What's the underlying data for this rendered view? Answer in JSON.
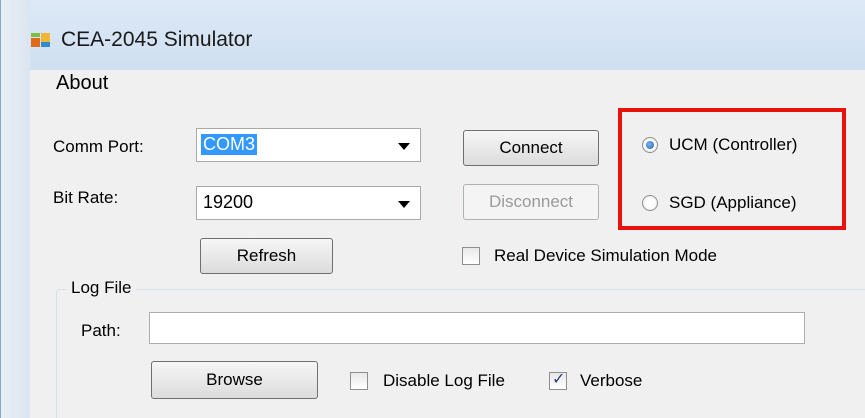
{
  "window": {
    "title": "CEA-2045 Simulator",
    "icon": "app-window-icon"
  },
  "menu": {
    "about": "About"
  },
  "connection": {
    "comm_port_label": "Comm Port:",
    "comm_port_value": "COM3",
    "bit_rate_label": "Bit Rate:",
    "bit_rate_value": "19200",
    "connect_label": "Connect",
    "disconnect_label": "Disconnect",
    "refresh_label": "Refresh",
    "real_device_label": "Real Device Simulation Mode",
    "real_device_checked": false
  },
  "mode": {
    "ucm_label": "UCM (Controller)",
    "sgd_label": "SGD (Appliance)",
    "selected": "UCM (Controller)",
    "highlight_color": "#e8120c"
  },
  "log_file": {
    "group_title": "Log File",
    "path_label": "Path:",
    "path_value": "",
    "browse_label": "Browse",
    "disable_label": "Disable Log File",
    "disable_checked": false,
    "verbose_label": "Verbose",
    "verbose_checked": true
  }
}
